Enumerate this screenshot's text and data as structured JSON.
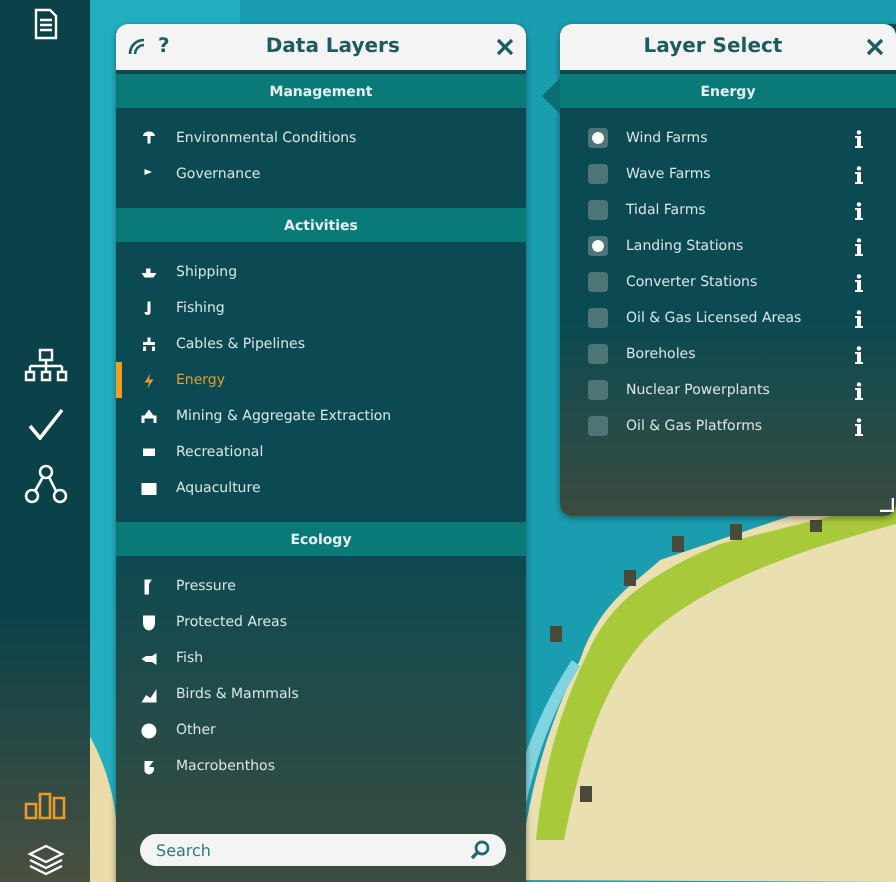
{
  "data_layers": {
    "help": "?",
    "title": "Data Layers",
    "sections": [
      {
        "title": "Management",
        "items": [
          {
            "label": "Environmental Conditions",
            "selected": false
          },
          {
            "label": "Governance",
            "selected": false
          }
        ]
      },
      {
        "title": "Activities",
        "items": [
          {
            "label": "Shipping",
            "selected": false
          },
          {
            "label": "Fishing",
            "selected": false
          },
          {
            "label": "Cables & Pipelines",
            "selected": false
          },
          {
            "label": "Energy",
            "selected": true
          },
          {
            "label": "Mining & Aggregate Extraction",
            "selected": false
          },
          {
            "label": "Recreational",
            "selected": false
          },
          {
            "label": "Aquaculture",
            "selected": false
          }
        ]
      },
      {
        "title": "Ecology",
        "items": [
          {
            "label": "Pressure",
            "selected": false
          },
          {
            "label": "Protected Areas",
            "selected": false
          },
          {
            "label": "Fish",
            "selected": false
          },
          {
            "label": "Birds & Mammals",
            "selected": false
          },
          {
            "label": "Other",
            "selected": false
          },
          {
            "label": "Macrobenthos",
            "selected": false
          }
        ]
      }
    ],
    "search": {
      "placeholder": "Search"
    }
  },
  "layer_select": {
    "title": "Layer Select",
    "section": "Energy",
    "layers": [
      {
        "label": "Wind Farms",
        "checked": true
      },
      {
        "label": "Wave Farms",
        "checked": false
      },
      {
        "label": "Tidal Farms",
        "checked": false
      },
      {
        "label": "Landing Stations",
        "checked": true
      },
      {
        "label": "Converter Stations",
        "checked": false
      },
      {
        "label": "Oil & Gas Licensed Areas",
        "checked": false
      },
      {
        "label": "Boreholes",
        "checked": false
      },
      {
        "label": "Nuclear Powerplants",
        "checked": false
      },
      {
        "label": "Oil & Gas Platforms",
        "checked": false
      }
    ]
  }
}
